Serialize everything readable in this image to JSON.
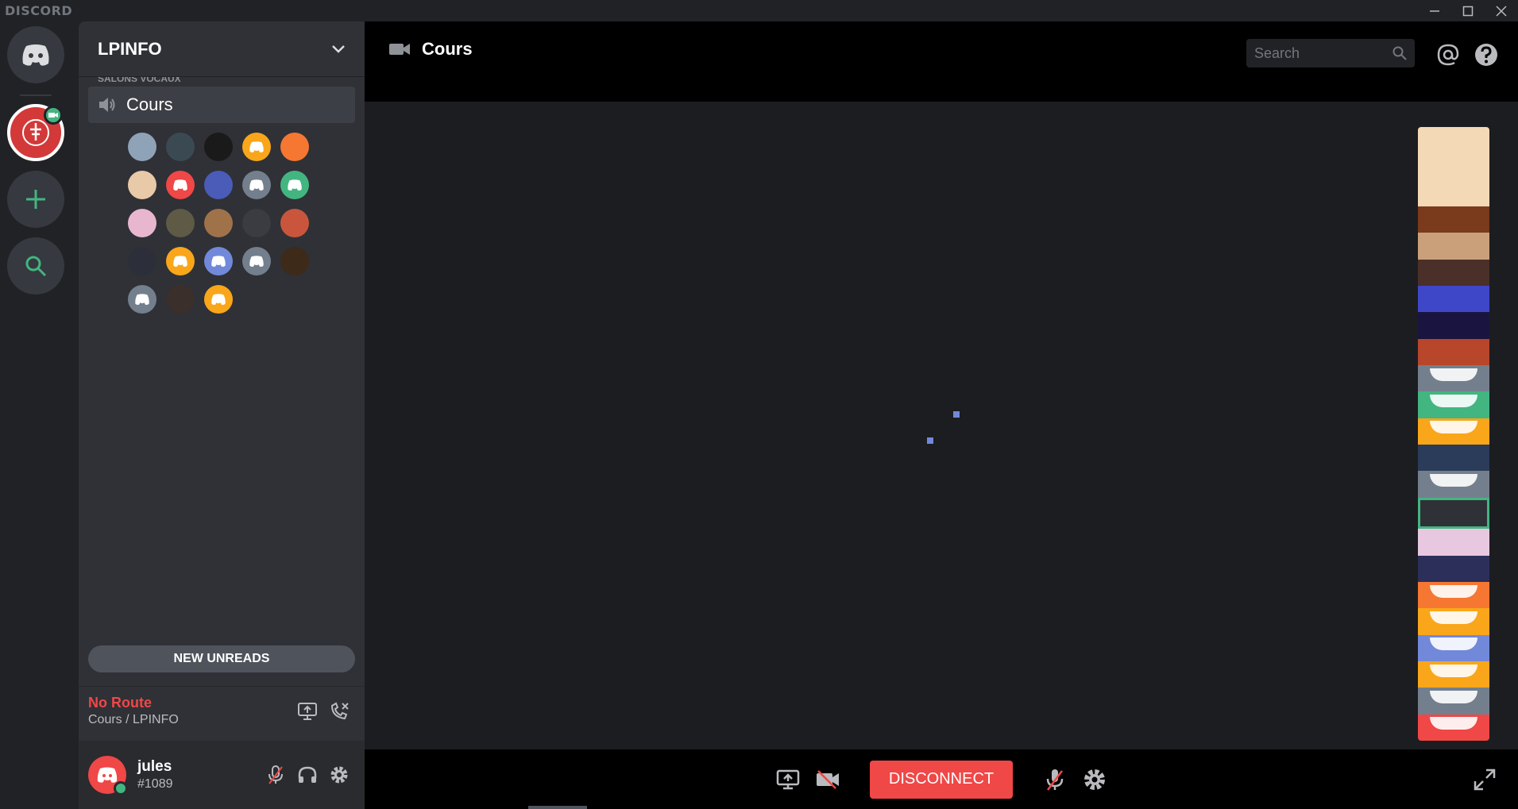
{
  "app": {
    "brand": "DISCORD"
  },
  "server": {
    "name": "LPINFO",
    "truncated_category": "SALONS VOCAUX"
  },
  "voice_channel": {
    "name": "Cours"
  },
  "participants": [
    {
      "color": "#8ea2b8"
    },
    {
      "color": "#3b4a52"
    },
    {
      "color": "#1a1a1a"
    },
    {
      "color": "#faa61a"
    },
    {
      "color": "#f57731"
    },
    {
      "color": "#e8c9a8"
    },
    {
      "color": "#f04747"
    },
    {
      "color": "#4a5bb8"
    },
    {
      "color": "#747f8d"
    },
    {
      "color": "#43b581"
    },
    {
      "color": "#e8b6cf"
    },
    {
      "color": "#5e5a46"
    },
    {
      "color": "#a0724a"
    },
    {
      "color": "#3a3c40"
    },
    {
      "color": "#c9563c"
    },
    {
      "color": "#2c2f3a"
    },
    {
      "color": "#faa61a"
    },
    {
      "color": "#7289da"
    },
    {
      "color": "#747f8d"
    },
    {
      "color": "#3d2a18"
    },
    {
      "color": "#747f8d"
    },
    {
      "color": "#3a2f2a"
    },
    {
      "color": "#faa61a"
    }
  ],
  "sidebar": {
    "new_unreads": "NEW UNREADS"
  },
  "connection": {
    "status": "No Route",
    "location": "Cours / LPINFO"
  },
  "user": {
    "name": "jules",
    "tag": "#1089"
  },
  "header": {
    "channel": "Cours",
    "search_placeholder": "Search"
  },
  "stream_tiles": [
    {
      "color": "#f4d9b6"
    },
    {
      "color": "#7a3a1c"
    },
    {
      "color": "#c9a07a"
    },
    {
      "color": "#4a3028"
    },
    {
      "color": "#3f47c9"
    },
    {
      "color": "#1a1540"
    },
    {
      "color": "#b8462a"
    },
    {
      "color": "#747f8d"
    },
    {
      "color": "#43b581"
    },
    {
      "color": "#faa61a"
    },
    {
      "color": "#2a3c5a"
    },
    {
      "color": "#747f8d"
    },
    {
      "color": "#2f3136"
    },
    {
      "color": "#e8c7e0"
    },
    {
      "color": "#2c2f5a"
    },
    {
      "color": "#f57731"
    },
    {
      "color": "#faa61a"
    },
    {
      "color": "#7289da"
    },
    {
      "color": "#faa61a"
    },
    {
      "color": "#747f8d"
    },
    {
      "color": "#f04747"
    }
  ],
  "controls": {
    "disconnect": "DISCONNECT"
  }
}
